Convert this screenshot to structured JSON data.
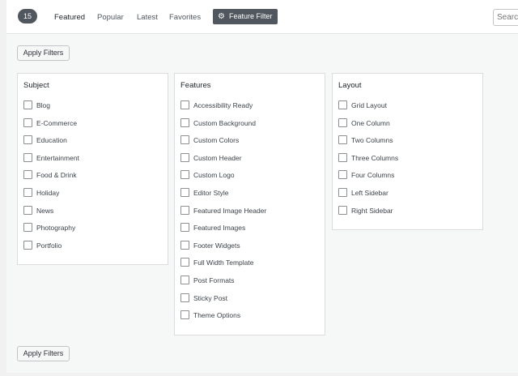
{
  "header": {
    "count": "15",
    "tabs": [
      "Featured",
      "Popular",
      "Latest",
      "Favorites"
    ],
    "feature_filter_label": "Feature Filter",
    "feature_filter_icon": "gear-icon",
    "search_placeholder": "Search"
  },
  "apply_filters_label": "Apply Filters",
  "panels": [
    {
      "title": "Subject",
      "options": [
        "Blog",
        "E-Commerce",
        "Education",
        "Entertainment",
        "Food & Drink",
        "Holiday",
        "News",
        "Photography",
        "Portfolio"
      ]
    },
    {
      "title": "Features",
      "options": [
        "Accessibility Ready",
        "Custom Background",
        "Custom Colors",
        "Custom Header",
        "Custom Logo",
        "Editor Style",
        "Featured Image Header",
        "Featured Images",
        "Footer Widgets",
        "Full Width Template",
        "Post Formats",
        "Sticky Post",
        "Theme Options"
      ]
    },
    {
      "title": "Layout",
      "options": [
        "Grid Layout",
        "One Column",
        "Two Columns",
        "Three Columns",
        "Four Columns",
        "Left Sidebar",
        "Right Sidebar"
      ]
    }
  ],
  "colors": {
    "accent_dark": "#50575e",
    "background": "#f1f1f1"
  }
}
